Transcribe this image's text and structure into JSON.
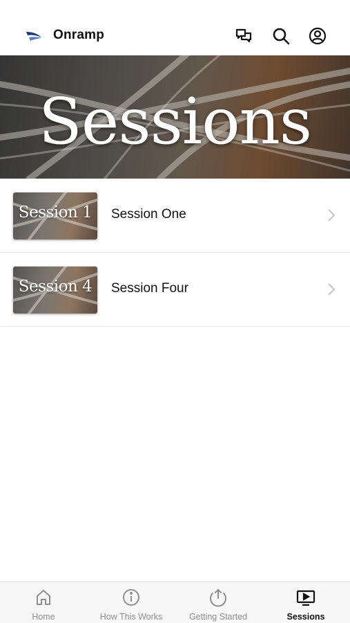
{
  "header": {
    "app_name": "Onramp",
    "icons": [
      "logo-icon",
      "chat-icon",
      "search-icon",
      "profile-icon"
    ]
  },
  "hero": {
    "title": "Sessions"
  },
  "sessions": [
    {
      "thumb_text": "Session 1",
      "title": "Session One"
    },
    {
      "thumb_text": "Session 4",
      "title": "Session Four"
    }
  ],
  "tabs": [
    {
      "label": "Home",
      "icon": "home-icon",
      "active": false
    },
    {
      "label": "How This Works",
      "icon": "info-icon",
      "active": false
    },
    {
      "label": "Getting Started",
      "icon": "upload-icon",
      "active": false
    },
    {
      "label": "Sessions",
      "icon": "play-screen-icon",
      "active": true
    }
  ],
  "colors": {
    "active_tab": "#111111",
    "inactive_tab": "#8e8e8e",
    "logo_blue": "#1f3a7a"
  }
}
